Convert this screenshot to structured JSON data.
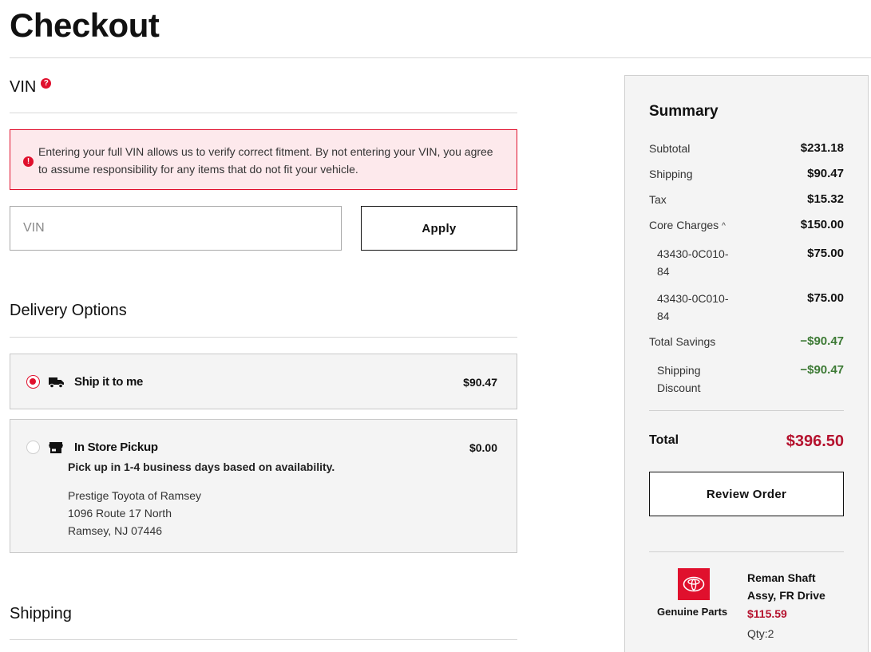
{
  "page": {
    "title": "Checkout"
  },
  "vin": {
    "heading": "VIN",
    "help_icon": "question-icon",
    "alert_text": "Entering your full VIN allows us to verify correct fitment. By not entering your VIN, you agree to assume responsibility for any items that do not fit your vehicle.",
    "alert_icon": "exclamation-icon",
    "input_value": "",
    "input_placeholder": "VIN",
    "apply_label": "Apply"
  },
  "delivery": {
    "heading": "Delivery Options",
    "options": [
      {
        "label": "Ship it to me",
        "price": "$90.47",
        "selected": true,
        "icon": "truck-icon"
      },
      {
        "label": "In Store Pickup",
        "price": "$0.00",
        "selected": false,
        "icon": "store-icon",
        "note": "Pick up in 1-4 business days based on availability.",
        "store_name": "Prestige Toyota of Ramsey",
        "store_address1": "1096 Route 17 North",
        "store_address2": "Ramsey, NJ 07446"
      }
    ]
  },
  "shipping": {
    "heading": "Shipping"
  },
  "summary": {
    "title": "Summary",
    "subtotal_label": "Subtotal",
    "subtotal": "$231.18",
    "shipping_label": "Shipping",
    "shipping": "$90.47",
    "tax_label": "Tax",
    "tax": "$15.32",
    "core_label": "Core Charges",
    "core": "$150.00",
    "core_items": [
      {
        "part": "43430-0C010-84",
        "amount": "$75.00"
      },
      {
        "part": "43430-0C010-84",
        "amount": "$75.00"
      }
    ],
    "savings_label": "Total Savings",
    "savings": "−$90.47",
    "ship_discount_label": "Shipping Discount",
    "ship_discount": "−$90.47",
    "total_label": "Total",
    "total": "$396.50",
    "review_label": "Review Order",
    "item": {
      "brand": "Genuine Parts",
      "logo_icon": "toyota-logo-icon",
      "name": "Reman Shaft Assy, FR Drive",
      "price": "$115.59",
      "qty": "Qty:2"
    }
  },
  "colors": {
    "accent": "#e0102d",
    "price_red": "#b5122e",
    "savings_green": "#3d7a35",
    "panel_bg": "#f4f4f4"
  }
}
